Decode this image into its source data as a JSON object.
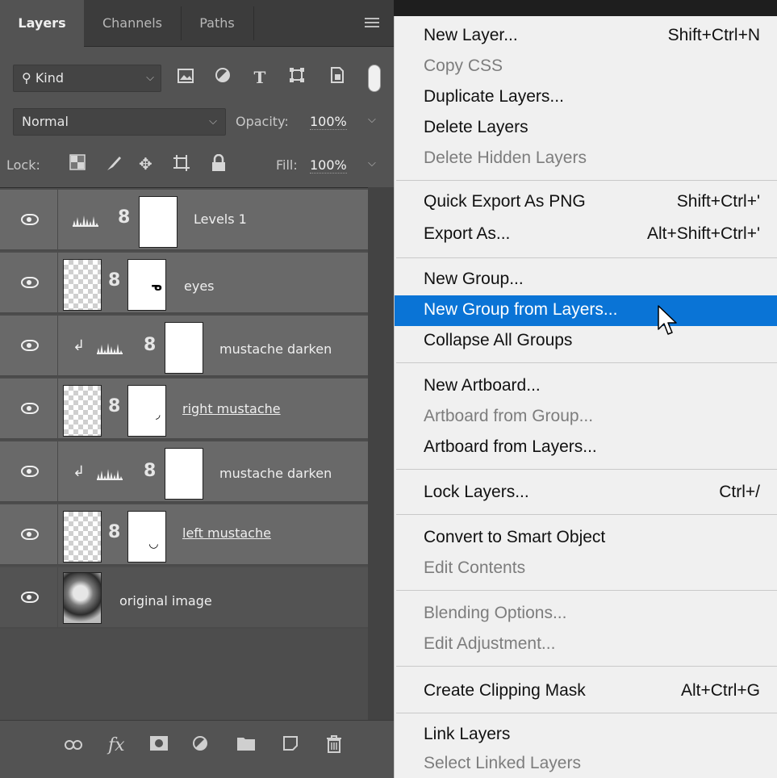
{
  "tabs": [
    {
      "label": "Layers",
      "active": true
    },
    {
      "label": "Channels",
      "active": false
    },
    {
      "label": "Paths",
      "active": false
    }
  ],
  "filter": {
    "kind_label": "Kind"
  },
  "blend": {
    "mode": "Normal",
    "opacity_label": "Opacity:",
    "opacity_value": "100%"
  },
  "lock": {
    "label": "Lock:",
    "fill_label": "Fill:",
    "fill_value": "100%"
  },
  "layers": [
    {
      "name": "Levels 1"
    },
    {
      "name": "eyes"
    },
    {
      "name": "mustache darken"
    },
    {
      "name": "right mustache"
    },
    {
      "name": "mustache darken"
    },
    {
      "name": "left mustache"
    },
    {
      "name": "original image"
    }
  ],
  "menu": {
    "new_layer": {
      "label": "New Layer...",
      "shortcut": "Shift+Ctrl+N"
    },
    "copy_css": {
      "label": "Copy CSS"
    },
    "duplicate_layers": {
      "label": "Duplicate Layers..."
    },
    "delete_layers": {
      "label": "Delete Layers"
    },
    "delete_hidden": {
      "label": "Delete Hidden Layers"
    },
    "quick_export": {
      "label": "Quick Export As PNG",
      "shortcut": "Shift+Ctrl+'"
    },
    "export_as": {
      "label": "Export As...",
      "shortcut": "Alt+Shift+Ctrl+'"
    },
    "new_group": {
      "label": "New Group..."
    },
    "new_group_from_layers": {
      "label": "New Group from Layers..."
    },
    "collapse_groups": {
      "label": "Collapse All Groups"
    },
    "new_artboard": {
      "label": "New Artboard..."
    },
    "artboard_from_group": {
      "label": "Artboard from Group..."
    },
    "artboard_from_layers": {
      "label": "Artboard from Layers..."
    },
    "lock_layers": {
      "label": "Lock Layers...",
      "shortcut": "Ctrl+/"
    },
    "convert_smart": {
      "label": "Convert to Smart Object"
    },
    "edit_contents": {
      "label": "Edit Contents"
    },
    "blending_options": {
      "label": "Blending Options..."
    },
    "edit_adjustment": {
      "label": "Edit Adjustment..."
    },
    "clipping_mask": {
      "label": "Create Clipping Mask",
      "shortcut": "Alt+Ctrl+G"
    },
    "link_layers": {
      "label": "Link Layers"
    },
    "select_linked": {
      "label": "Select Linked Layers"
    }
  },
  "colors": {
    "highlight": "#0a74d6",
    "panel": "#535353",
    "selected_row": "#696969"
  }
}
